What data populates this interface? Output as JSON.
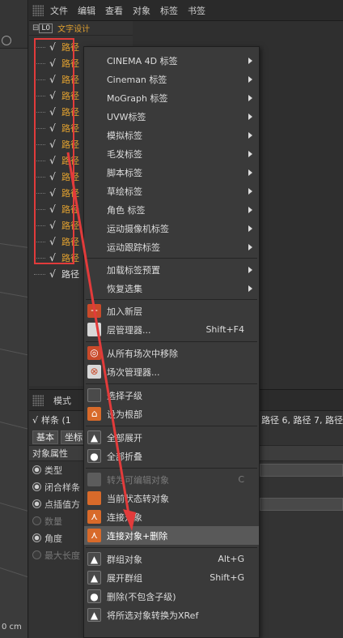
{
  "menubar": {
    "items": [
      "文件",
      "编辑",
      "查看",
      "对象",
      "标签",
      "书签"
    ]
  },
  "viewport": {
    "unit_readout": "0 cm"
  },
  "object_manager": {
    "level": "L0",
    "root_name": "文字设计",
    "item_label": "路径",
    "items_count_visible": 15
  },
  "context_menu": {
    "tag_submenus": [
      "CINEMA 4D 标签",
      "Cineman 标签",
      "MoGraph 标签",
      "UVW标签",
      "模拟标签",
      "毛发标签",
      "脚本标签",
      "草绘标签",
      "角色 标签",
      "运动摄像机标签",
      "运动跟踪标签"
    ],
    "load_tag_preset": "加载标签预置",
    "restore_selection": "恢复选集",
    "add_layer": "加入新层",
    "layer_manager": "层管理器...",
    "layer_manager_shortcut": "Shift+F4",
    "remove_from_takes": "从所有场次中移除",
    "take_manager": "场次管理器...",
    "select_children": "选择子级",
    "set_as_root": "设为根部",
    "expand_all": "全部展开",
    "collapse_all": "全部折叠",
    "make_editable": "转为可编辑对象",
    "make_editable_shortcut": "C",
    "current_state_to_object": "当前状态转对象",
    "connect_objects": "连接对象",
    "connect_objects_delete": "连接对象+删除",
    "group_objects": "群组对象",
    "group_objects_shortcut": "Alt+G",
    "expand_group": "展开群组",
    "expand_group_shortcut": "Shift+G",
    "delete_without_children": "删除(不包含子级)",
    "convert_to_xref": "将所选对象转换为XRef"
  },
  "attribute_manager": {
    "mode_label": "模式",
    "object_line": "样条 (1",
    "path_list": "路径 6, 路径 7, 路径",
    "tabs": [
      "基本",
      "坐标"
    ],
    "section": "对象属性",
    "rows": [
      {
        "label": "类型",
        "dim": false
      },
      {
        "label": "闭合样条",
        "dim": false
      },
      {
        "label": "点插值方",
        "dim": false
      },
      {
        "label": "数量",
        "dim": true
      },
      {
        "label": "角度",
        "dim": false
      },
      {
        "label": "最大长度",
        "dim": true
      }
    ]
  },
  "colors": {
    "highlight_box": "#e23b3b",
    "object_label": "#e0a030",
    "menu_highlight": "#595959"
  }
}
